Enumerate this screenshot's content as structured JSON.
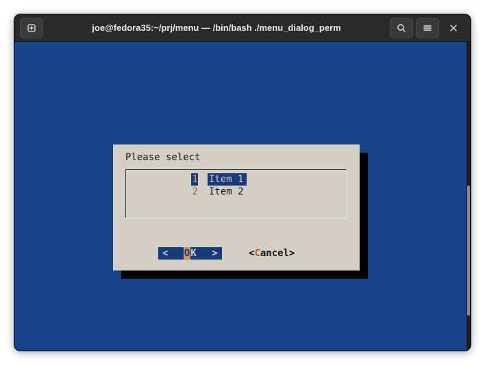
{
  "window": {
    "title": "joe@fedora35:~/prj/menu — /bin/bash ./menu_dialog_perm"
  },
  "terminal": {
    "bg": "#17438a"
  },
  "dialog": {
    "prompt": "Please select",
    "items": [
      {
        "tag": "1",
        "label": "Item 1"
      },
      {
        "tag": "2",
        "label": "Item 2"
      }
    ],
    "ok_hotkey": "O",
    "ok_rest": "K",
    "cancel_hotkey": "C",
    "cancel_rest": "ancel"
  }
}
